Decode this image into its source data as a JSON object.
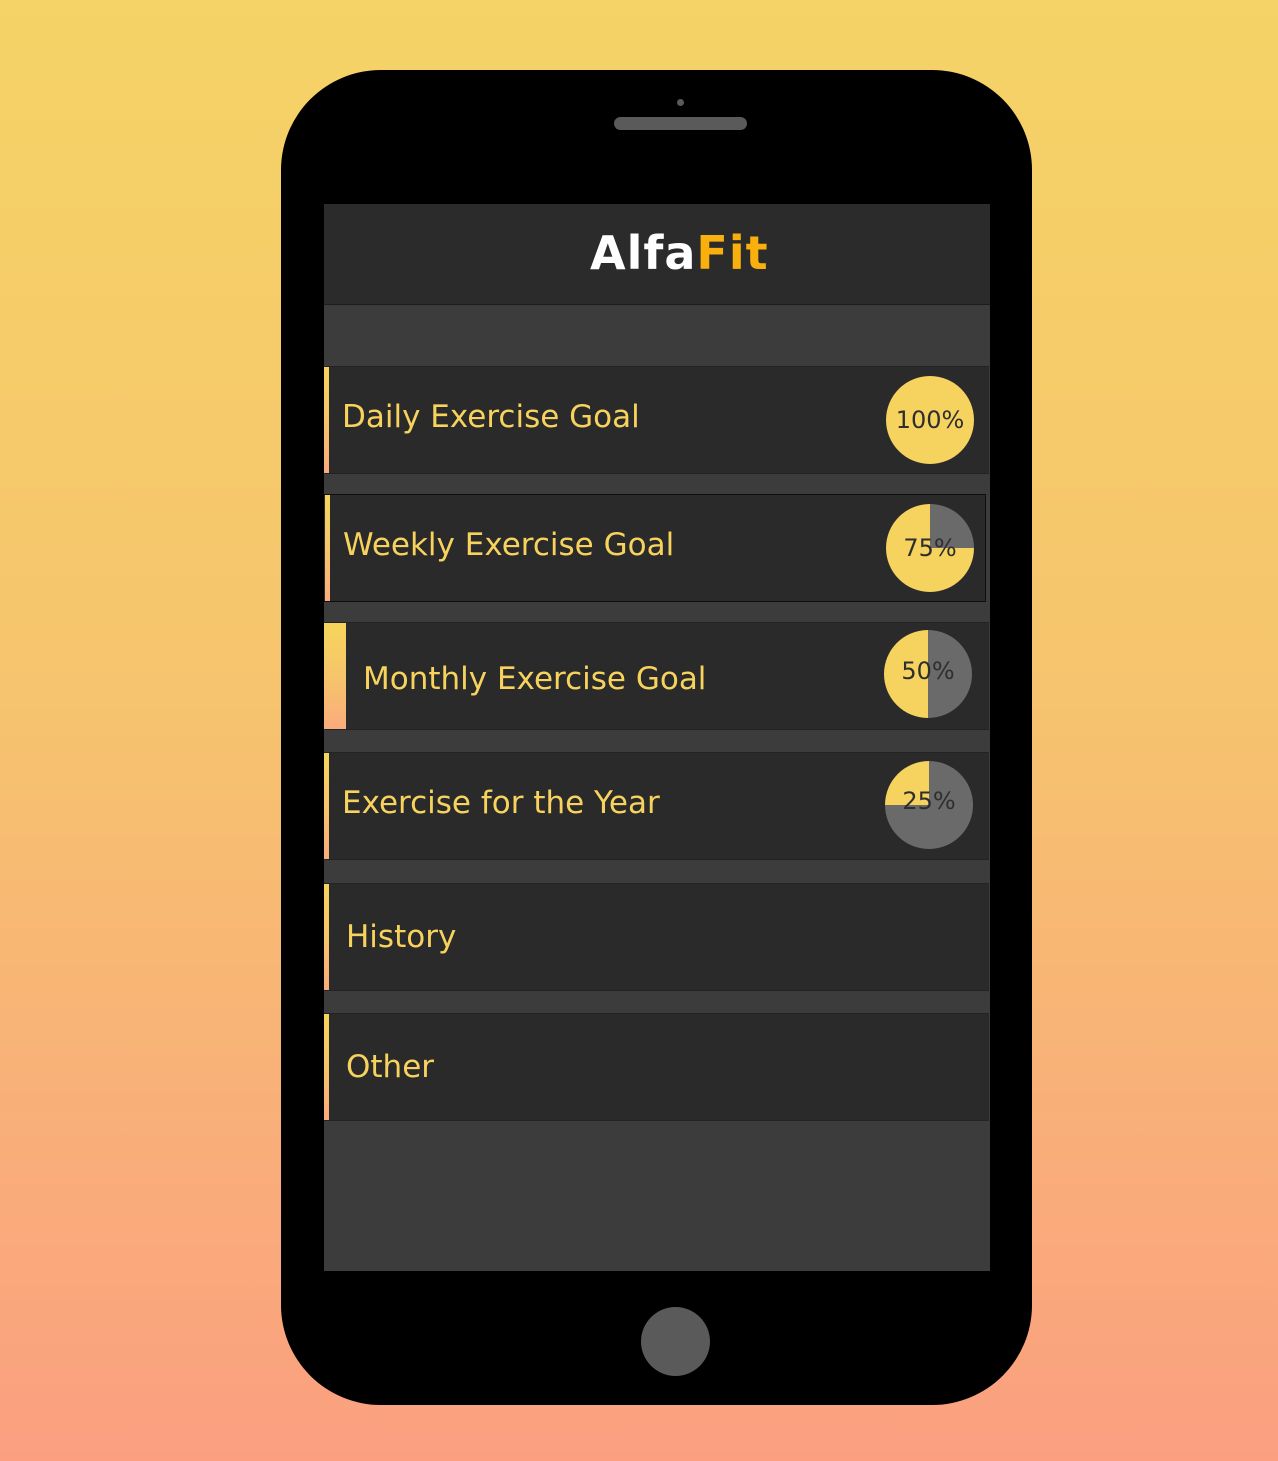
{
  "app": {
    "logo_part1": "Alfa",
    "logo_part2": "Fit"
  },
  "menu": {
    "items": [
      {
        "label": "Daily Exercise Goal",
        "progress": 1.0,
        "progress_label": "100%"
      },
      {
        "label": "Weekly Exercise Goal",
        "progress": 0.75,
        "progress_label": "75%"
      },
      {
        "label": "Monthly Exercise Goal",
        "progress": 0.5,
        "progress_label": "50%"
      },
      {
        "label": "Exercise for the Year",
        "progress": 0.25,
        "progress_label": "25%"
      },
      {
        "label": "History"
      },
      {
        "label": "Other"
      }
    ]
  },
  "colors": {
    "accent_yellow": "#f5d35e",
    "pie_remaining": "#6a6a6a",
    "logo_orange": "#f9b00e",
    "background_top": "#f5d366",
    "background_bottom": "#fb9f80"
  },
  "icons": {
    "device": "smartphone",
    "progress": "pie-chart"
  }
}
